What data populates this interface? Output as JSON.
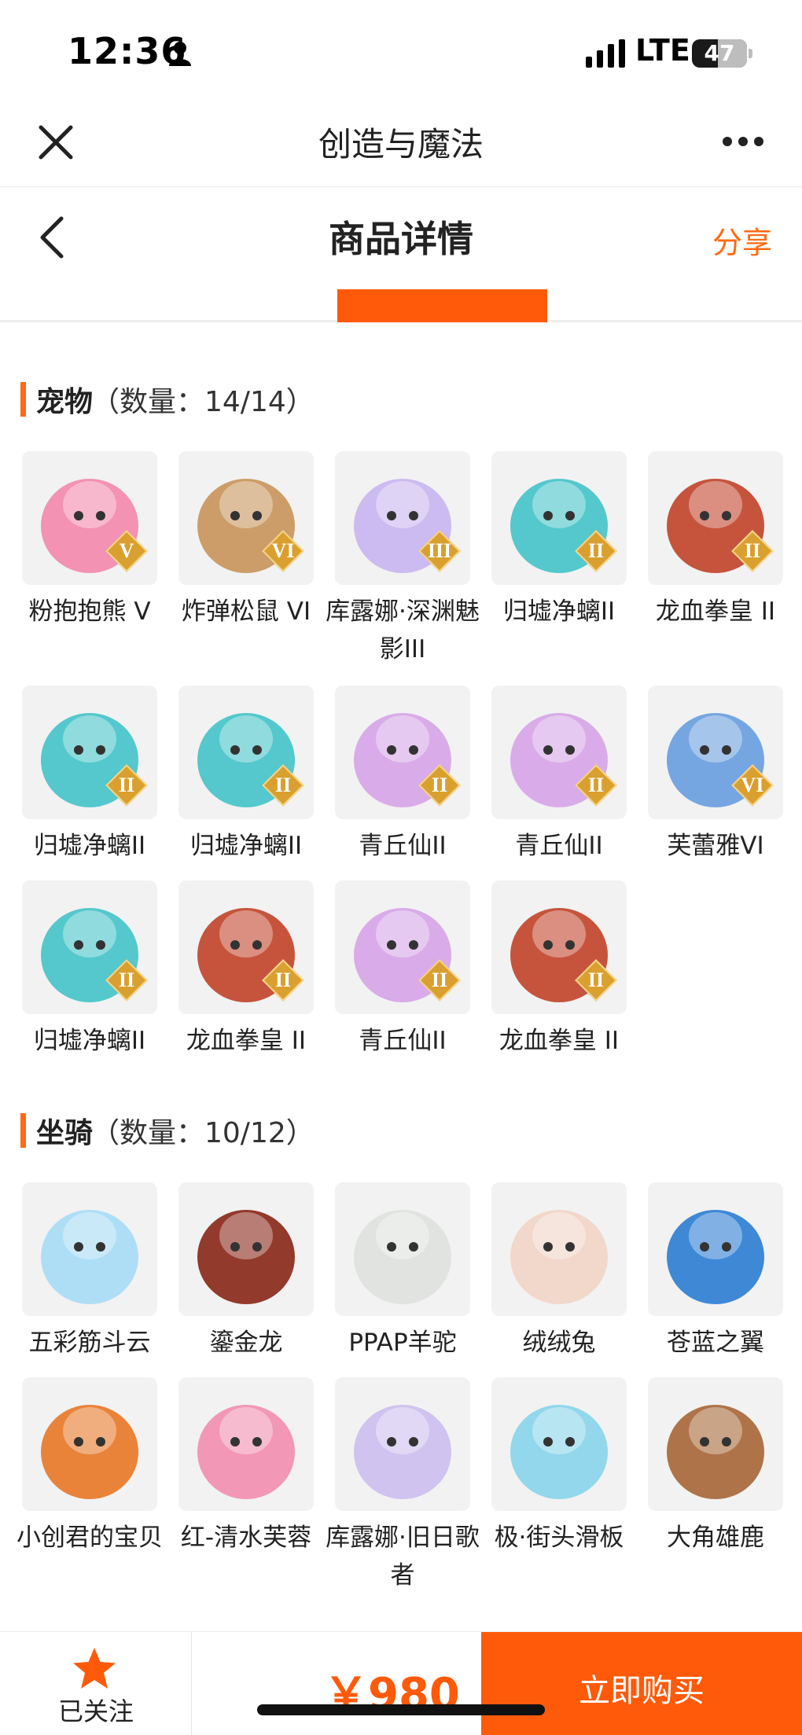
{
  "status_bar": {
    "time": "12:36",
    "network": "LTE",
    "battery": "47",
    "battery_level": 0.47
  },
  "app_header": {
    "title": "创造与魔法"
  },
  "page_header": {
    "title": "商品详情",
    "share_label": "分享"
  },
  "pets": {
    "title": "宠物",
    "count_label": "（数量：14/14）",
    "items": [
      {
        "name": "粉抱抱熊 V",
        "badge": "V",
        "icon": "pink-bear-icon",
        "color": "#f38aae"
      },
      {
        "name": "炸弹松鼠 VI",
        "badge": "VI",
        "icon": "bomb-squirrel-icon",
        "color": "#c9965d"
      },
      {
        "name": "库露娜·深渊魅影III",
        "badge": "III",
        "icon": "kuluna-icon",
        "color": "#c9b6f0"
      },
      {
        "name": "归墟净螭II",
        "badge": "II",
        "icon": "cyan-dragon-icon",
        "color": "#46c4c9"
      },
      {
        "name": "龙血拳皇 II",
        "badge": "II",
        "icon": "red-minotaur-icon",
        "color": "#c2462d"
      },
      {
        "name": "归墟净螭II",
        "badge": "II",
        "icon": "cyan-dragon-icon",
        "color": "#46c4c9"
      },
      {
        "name": "归墟净螭II",
        "badge": "II",
        "icon": "cyan-dragon-icon",
        "color": "#46c4c9"
      },
      {
        "name": "青丘仙II",
        "badge": "II",
        "icon": "fox-fairy-icon",
        "color": "#d7a6e8"
      },
      {
        "name": "青丘仙II",
        "badge": "II",
        "icon": "fox-fairy-icon",
        "color": "#d7a6e8"
      },
      {
        "name": "芙蕾雅VI",
        "badge": "VI",
        "icon": "freya-icon",
        "color": "#6a9fe0"
      },
      {
        "name": "归墟净螭II",
        "badge": "II",
        "icon": "cyan-dragon-icon",
        "color": "#46c4c9"
      },
      {
        "name": "龙血拳皇 II",
        "badge": "II",
        "icon": "red-minotaur-icon",
        "color": "#c2462d"
      },
      {
        "name": "青丘仙II",
        "badge": "II",
        "icon": "fox-fairy-icon",
        "color": "#d7a6e8"
      },
      {
        "name": "龙血拳皇 II",
        "badge": "II",
        "icon": "red-minotaur-icon",
        "color": "#c2462d"
      }
    ]
  },
  "mounts": {
    "title": "坐骑",
    "count_label": "（数量：10/12）",
    "items": [
      {
        "name": "五彩筋斗云",
        "icon": "cloud-icon",
        "color": "#a8dcf5"
      },
      {
        "name": "鎏金龙",
        "icon": "gold-dragon-icon",
        "color": "#8a2a1a"
      },
      {
        "name": "PPAP羊驼",
        "icon": "alpaca-icon",
        "color": "#dfe2df"
      },
      {
        "name": "绒绒兔",
        "icon": "rabbit-icon",
        "color": "#f2d5c8"
      },
      {
        "name": "苍蓝之翼",
        "icon": "blue-wing-icon",
        "color": "#2f7fd4"
      },
      {
        "name": "小创君的宝贝",
        "icon": "parrot-icon",
        "color": "#e87a2a"
      },
      {
        "name": "红-清水芙蓉",
        "icon": "lotus-icon",
        "color": "#f28fb0"
      },
      {
        "name": "库露娜·旧日歌者",
        "icon": "kuluna-singer-icon",
        "color": "#cdbff0"
      },
      {
        "name": "极·街头滑板",
        "icon": "skateboard-icon",
        "color": "#8ad5ea"
      },
      {
        "name": "大角雄鹿",
        "icon": "deer-icon",
        "color": "#a8683a"
      }
    ]
  },
  "bottom_bar": {
    "follow_label": "已关注",
    "price": "￥980",
    "buy_label": "立即购买"
  },
  "colors": {
    "accent": "#ff5a0a",
    "badge_gold": "#d9a030"
  }
}
